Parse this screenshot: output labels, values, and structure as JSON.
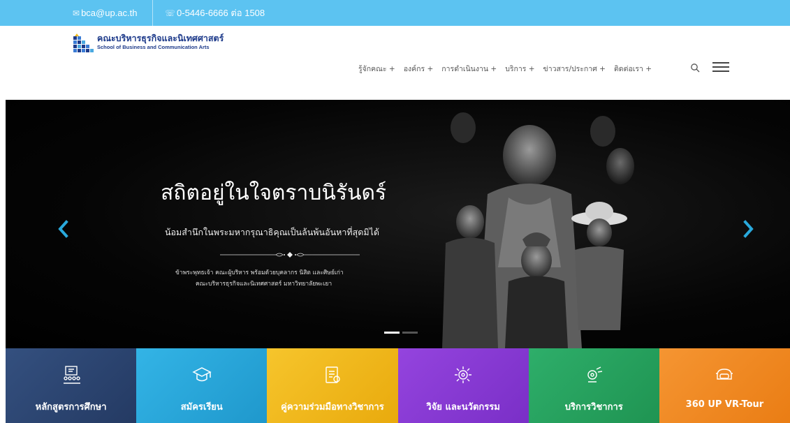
{
  "topbar": {
    "email": "bca@up.ac.th",
    "phone": "0-5446-6666 ต่อ 1508"
  },
  "logo": {
    "thai": "คณะบริหารธุรกิจและนิเทศศาสตร์",
    "english": "School of Business and Communication Arts"
  },
  "nav": {
    "items": [
      "รู้จักคณะ +",
      "องค์กร +",
      "การดำเนินงาน +",
      "บริการ +",
      "ข่าวสาร/ประกาศ +",
      "ติดต่อเรา +"
    ]
  },
  "hero": {
    "title": "สถิตอยู่ในใจตราบนิรันดร์",
    "subtitle": "น้อมสำนึกในพระมหากรุณาธิคุณเป็นล้นพ้นอันหาที่สุดมิได้",
    "line1": "ข้าพระพุทธเจ้า คณะผู้บริหาร พร้อมด้วยบุคลากร นิสิต และศิษย์เก่า",
    "line2": "คณะบริหารธุรกิจและนิเทศศาสตร์ มหาวิทยาลัยพะเยา"
  },
  "tiles": [
    {
      "label": "หลักสูตรการศึกษา",
      "color": "#2f4a7a",
      "icon": "curriculum-icon"
    },
    {
      "label": "สมัครเรียน",
      "color": "#29a9dc",
      "icon": "graduation-cap-icon"
    },
    {
      "label": "คู่ความร่วมมือทางวิชาการ",
      "color": "#f2bb1a",
      "icon": "document-icon"
    },
    {
      "label": "วิจัย และนวัตกรรม",
      "color": "#8a3ad6",
      "icon": "research-icon"
    },
    {
      "label": "บริการวิชาการ",
      "color": "#25a25f",
      "icon": "service-icon"
    },
    {
      "label": "360 UP VR-Tour",
      "color": "#f08a24",
      "icon": "vr-360-icon"
    }
  ],
  "colors": {
    "topbar": "#5cc3f1",
    "logo": "#1d3a8a",
    "accent": "#29a9dc"
  }
}
